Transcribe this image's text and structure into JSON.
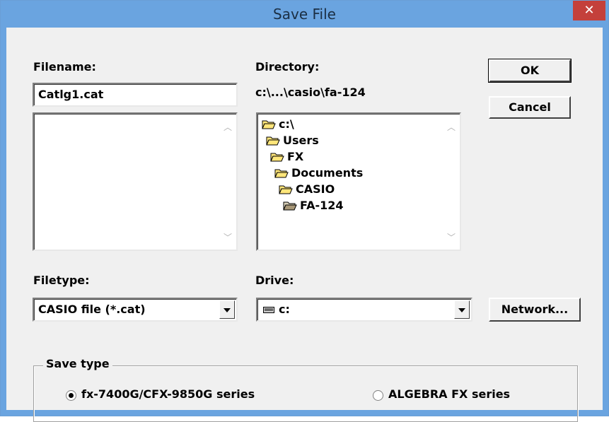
{
  "window": {
    "title": "Save File",
    "close_glyph": "✕"
  },
  "filename": {
    "label": "Filename:",
    "value": "Catlg1.cat"
  },
  "directory": {
    "label": "Directory:",
    "path": "c:\\...\\casio\\fa-124",
    "tree": [
      {
        "name": "c:\\",
        "icon": "open-folder-icon"
      },
      {
        "name": "Users",
        "icon": "open-folder-icon"
      },
      {
        "name": "FX",
        "icon": "open-folder-icon"
      },
      {
        "name": "Documents",
        "icon": "open-folder-icon"
      },
      {
        "name": "CASIO",
        "icon": "open-folder-icon"
      },
      {
        "name": "FA-124",
        "icon": "open-folder-grey-icon"
      }
    ]
  },
  "buttons": {
    "ok": "OK",
    "cancel": "Cancel",
    "network": "Network..."
  },
  "filetype": {
    "label": "Filetype:",
    "selected": "CASIO file (*.cat)"
  },
  "drive": {
    "label": "Drive:",
    "selected": "c:",
    "icon": "drive-icon"
  },
  "save_type": {
    "legend": "Save type",
    "options": [
      {
        "label": "fx-7400G/CFX-9850G series",
        "checked": true
      },
      {
        "label": "ALGEBRA FX series",
        "checked": false
      }
    ]
  },
  "colors": {
    "title_bar": "#6aa4e0",
    "close_button": "#c4403b",
    "dialog_bg": "#f0f0f0"
  }
}
